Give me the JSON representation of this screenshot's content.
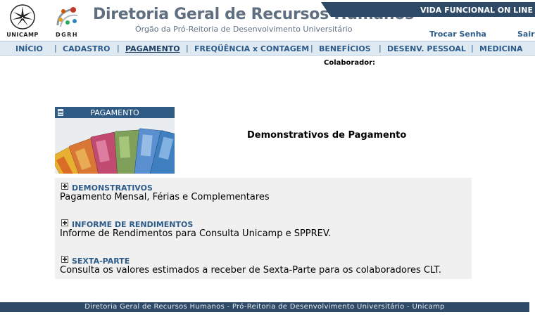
{
  "header": {
    "unicamp_label": "UNICAMP",
    "dgrh_label": "DGRH",
    "title": "Diretoria Geral de Recursos Humanos",
    "subtitle": "Órgão da Pró-Reitoria de Desenvolvimento Universitário",
    "banner": "VIDA FUNCIONAL ON LINE",
    "links": {
      "trocar_senha": "Trocar Senha",
      "sair": "Sair"
    }
  },
  "nav": {
    "items": [
      "INÍCIO",
      "CADASTRO",
      "PAGAMENTO",
      "FREQÜÊNCIA x CONTAGEM",
      "BENEFÍCIOS",
      "DESENV. PESSOAL",
      "MEDICINA"
    ],
    "separator": "|",
    "active": "PAGAMENTO"
  },
  "colaborador_label": "Colaborador:",
  "panel": {
    "header": "PAGAMENTO",
    "image_icon": "banknotes-image",
    "doc_icon": "document-icon"
  },
  "page_title": "Demonstrativos de Pagamento",
  "items": [
    {
      "title": "DEMONSTRATIVOS",
      "desc": "Pagamento Mensal, Férias e Complementares"
    },
    {
      "title": "INFORME DE RENDIMENTOS",
      "desc": "Informe de Rendimentos para Consulta Unicamp e SPPREV."
    },
    {
      "title": "SEXTA-PARTE",
      "desc": "Consulta os valores estimados a receber de Sexta-Parte para os colaboradores CLT."
    }
  ],
  "footer": "Diretoria Geral de Recursos Humanos - Pró-Reitoria de Desenvolvimento Universitário - Unicamp",
  "colors": {
    "nav_bg": "#dfe9f2",
    "link": "#2e5c8a",
    "dark_bar": "#2e4a66",
    "panel_header": "#2e5a84"
  }
}
